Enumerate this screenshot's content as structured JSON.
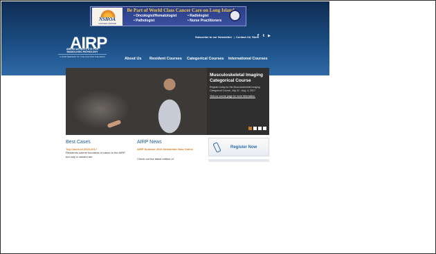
{
  "ad": {
    "headline": "Be Part of World Class Cancer Care on Long Island",
    "logo_text": "NSHOA",
    "logo_sub": "CANCER CENTER",
    "roles": [
      "• Oncologist/Hematologist",
      "• Radiologist",
      "• Pathologist",
      "• Nurse Practitioners"
    ]
  },
  "header": {
    "logo_mark": "AIRP",
    "logo_sub": "AMERICAN INSTITUTE FOR RADIOLOGIC PATHOLOGY",
    "logo_tag": "A PARTNERSHIP OF THE ACR AND THE ARRS",
    "util_links": [
      "Subscribe to our Newsletter",
      "Contact Us",
      "Store"
    ],
    "social_icons": [
      "facebook-icon",
      "twitter-icon",
      "youtube-icon"
    ],
    "nav": [
      "About Us",
      "Resident Courses",
      "Categorical Courses",
      "International Courses"
    ]
  },
  "hero": {
    "title": "Musculoskeletal Imaging Categorical Course",
    "desc": "Register today for the Musculoskeletal Imaging Categorical Course, July 31 - Aug. 4, 2017.",
    "link": "Visit our course page for more information.",
    "dots_colors": [
      "#c8782a",
      "#ffffff",
      "#ffffff",
      "#ffffff"
    ]
  },
  "best_cases": {
    "heading": "Best Cases",
    "subheading": "Top Cases of 2015-2017",
    "text": "Residents submit hundreds of cases to the AIRP, but only a handful are"
  },
  "news": {
    "heading": "AIRP News",
    "subheading": "AIRP Summer 2016 Newsletter Now Online",
    "text": "Check out the latest edition of"
  },
  "register": {
    "label": "Register Now"
  }
}
